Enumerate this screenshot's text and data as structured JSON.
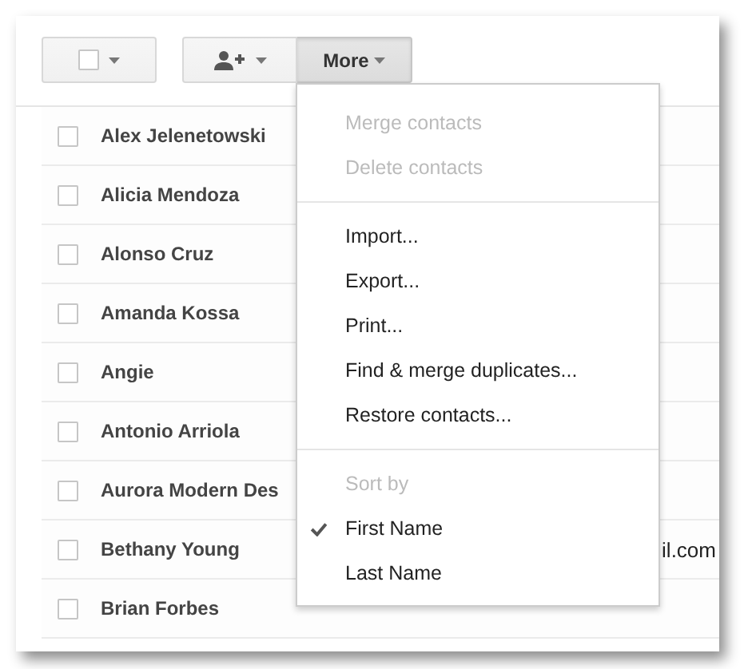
{
  "toolbar": {
    "select_button": {
      "checked": false
    },
    "more_button": {
      "label": "More",
      "expanded": true
    }
  },
  "contacts": [
    {
      "name": "Alex Jelenetowski",
      "checked": false
    },
    {
      "name": "Alicia Mendoza",
      "checked": false
    },
    {
      "name": "Alonso Cruz",
      "checked": false
    },
    {
      "name": "Amanda Kossa",
      "checked": false
    },
    {
      "name": "Angie",
      "checked": false
    },
    {
      "name": "Antonio Arriola",
      "checked": false
    },
    {
      "name": "Aurora Modern Des",
      "checked": false
    },
    {
      "name": "Bethany Young",
      "checked": false,
      "column_2": "il.com"
    },
    {
      "name": "Brian Forbes",
      "checked": false
    }
  ],
  "menu": {
    "sections": [
      [
        {
          "label": "Merge contacts",
          "disabled": true
        },
        {
          "label": "Delete contacts",
          "disabled": true
        }
      ],
      [
        {
          "label": "Import...",
          "disabled": false
        },
        {
          "label": "Export...",
          "disabled": false
        },
        {
          "label": "Print...",
          "disabled": false
        },
        {
          "label": "Find & merge duplicates...",
          "disabled": false
        },
        {
          "label": "Restore contacts...",
          "disabled": false
        }
      ],
      [
        {
          "label": "Sort by",
          "kind": "heading"
        },
        {
          "label": "First Name",
          "kind": "option",
          "selected": true
        },
        {
          "label": "Last Name",
          "kind": "option",
          "selected": false
        }
      ]
    ]
  }
}
